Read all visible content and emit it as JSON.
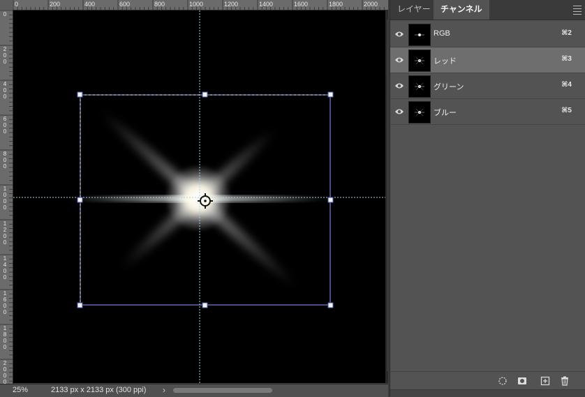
{
  "ruler": {
    "top_labels": [
      "0",
      "200",
      "400",
      "600",
      "800",
      "1000",
      "1200",
      "1400",
      "1600",
      "1800",
      "2000"
    ],
    "left_labels": [
      "0",
      "200",
      "400",
      "600",
      "800",
      "1000",
      "1200",
      "1400",
      "1600",
      "1800",
      "2000"
    ]
  },
  "status": {
    "zoom": "25%",
    "doc_info": "2133 px x 2133 px (300 ppi)",
    "arrow": "›"
  },
  "panel": {
    "tabs": [
      {
        "label": "レイヤー",
        "active": false
      },
      {
        "label": "チャンネル",
        "active": true
      }
    ],
    "channels": [
      {
        "name": "RGB",
        "shortcut": "⌘2",
        "selected": false
      },
      {
        "name": "レッド",
        "shortcut": "⌘3",
        "selected": true
      },
      {
        "name": "グリーン",
        "shortcut": "⌘4",
        "selected": false
      },
      {
        "name": "ブルー",
        "shortcut": "⌘5",
        "selected": false
      }
    ],
    "bottom_icons": [
      "load-selection-icon",
      "save-mask-icon",
      "new-channel-icon",
      "delete-icon"
    ]
  },
  "colors": {
    "canvas_bg": "#000000",
    "guide": "#9fd8e8",
    "bbox": "#8ea0ff",
    "panel_bg": "#535353",
    "selected_row": "#6e6e6e"
  }
}
